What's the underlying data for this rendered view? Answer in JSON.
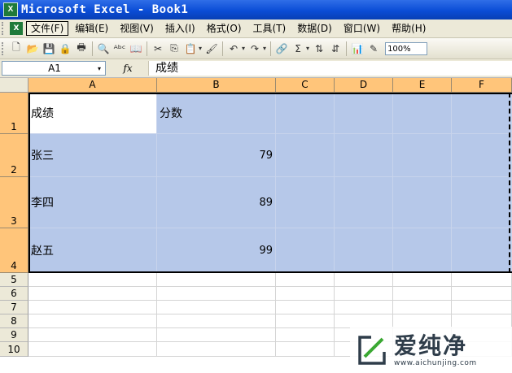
{
  "window": {
    "title": "Microsoft Excel - Book1",
    "app_icon": "X"
  },
  "menubar": {
    "items": [
      {
        "label": "文件(F)",
        "active": true
      },
      {
        "label": "编辑(E)"
      },
      {
        "label": "视图(V)"
      },
      {
        "label": "插入(I)"
      },
      {
        "label": "格式(O)"
      },
      {
        "label": "工具(T)"
      },
      {
        "label": "数据(D)"
      },
      {
        "label": "窗口(W)"
      },
      {
        "label": "帮助(H)"
      }
    ]
  },
  "toolbar": {
    "zoom": "100%",
    "icons": {
      "new": "🗋",
      "open": "📂",
      "save": "💾",
      "permission": "🔒",
      "print": "🖶",
      "preview": "🔍",
      "spell": "ᴬᵇᶜ",
      "research": "📖",
      "cut": "✂",
      "copy": "⎘",
      "paste": "📋",
      "format_painter": "🖌",
      "undo": "↶",
      "redo": "↷",
      "hyperlink": "🔗",
      "autosum": "Σ",
      "sort_asc": "⇅",
      "sort_desc": "⇵",
      "chart": "📊",
      "drawing": "✎",
      "dropdown": "▾"
    }
  },
  "formula_bar": {
    "name_box": "A1",
    "fx": "fx",
    "content": "成绩"
  },
  "grid": {
    "columns": [
      "A",
      "B",
      "C",
      "D",
      "E",
      "F"
    ],
    "rows": [
      "1",
      "2",
      "3",
      "4",
      "5",
      "6",
      "7",
      "8",
      "9",
      "10"
    ],
    "cells": {
      "A1": "成绩",
      "B1": "分数",
      "A2": "张三",
      "B2": "79",
      "A3": "李四",
      "B3": "89",
      "A4": "赵五",
      "B4": "99"
    }
  },
  "watermark": {
    "main": "爱纯净",
    "url": "www.aichunjing.com"
  },
  "colors": {
    "selection": "#b6c8e9",
    "header_selected": "#ffc57a",
    "title_bar": "#0b4dd6",
    "ui_face": "#ece9d8"
  }
}
